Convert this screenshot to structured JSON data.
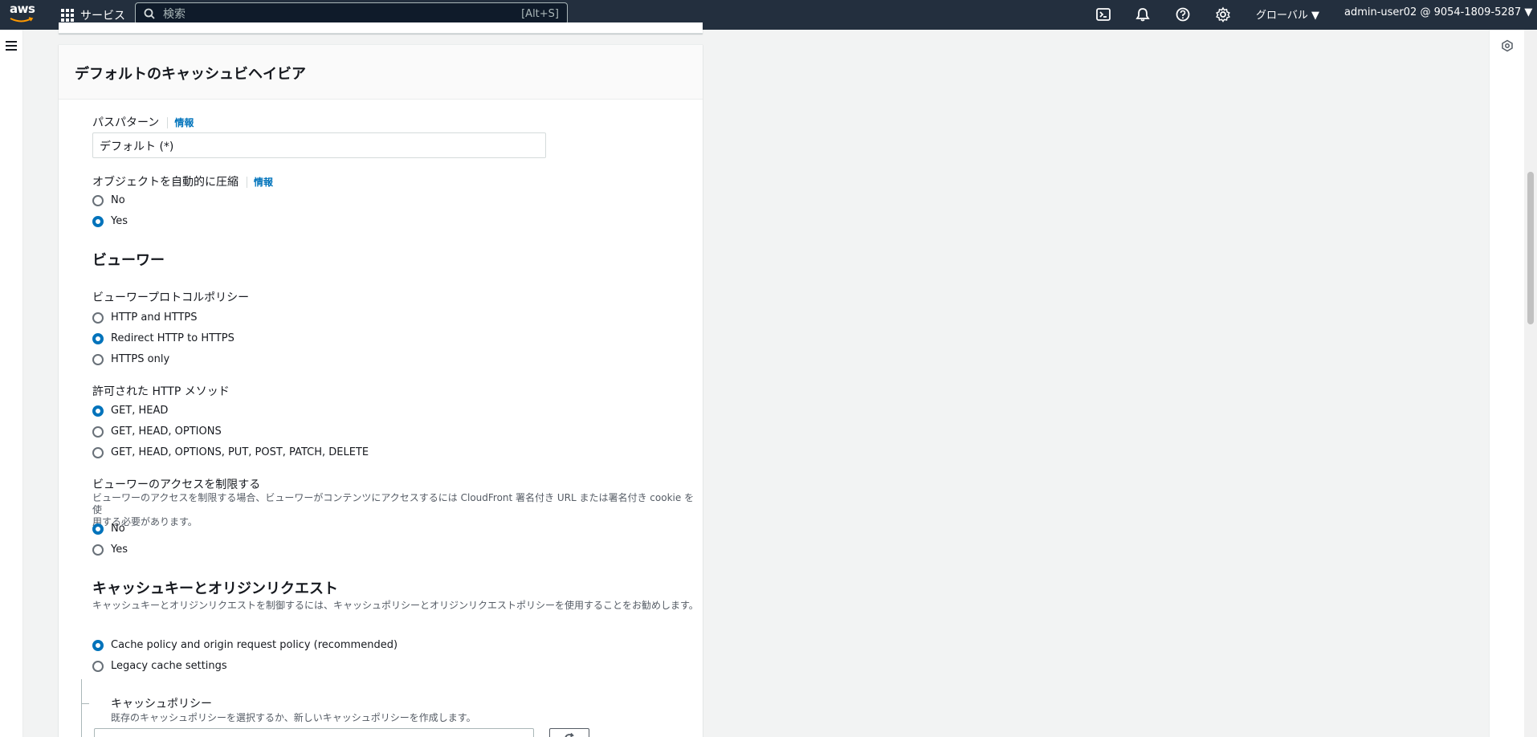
{
  "nav": {
    "logo_text": "aws",
    "services_label": "サービス",
    "search_placeholder": "検索",
    "search_shortcut": "[Alt+S]",
    "region": "グローバル ▼",
    "account": "admin-user02 @ 9054-1809-5287 ▼",
    "icons": [
      "cloudshell-icon",
      "bell-icon",
      "help-icon",
      "settings-icon"
    ]
  },
  "panel": {
    "title": "デフォルトのキャッシュビヘイビア",
    "path_pattern": {
      "label": "パスパターン",
      "info": "情報",
      "value": "デフォルト (*)"
    },
    "compress": {
      "label": "オブジェクトを自動的に圧縮",
      "info": "情報",
      "options": [
        {
          "label": "No",
          "checked": false
        },
        {
          "label": "Yes",
          "checked": true
        }
      ]
    },
    "viewer": {
      "title": "ビューワー",
      "protocol": {
        "label": "ビューワープロトコルポリシー",
        "options": [
          {
            "label": "HTTP and HTTPS",
            "checked": false
          },
          {
            "label": "Redirect HTTP to HTTPS",
            "checked": true
          },
          {
            "label": "HTTPS only",
            "checked": false
          }
        ]
      },
      "methods": {
        "label": "許可された HTTP メソッド",
        "options": [
          {
            "label": "GET, HEAD",
            "checked": true
          },
          {
            "label": "GET, HEAD, OPTIONS",
            "checked": false
          },
          {
            "label": "GET, HEAD, OPTIONS, PUT, POST, PATCH, DELETE",
            "checked": false
          }
        ]
      },
      "restrict": {
        "label": "ビューワーのアクセスを制限する",
        "desc_line1": "ビューワーのアクセスを制限する場合、ビューワーがコンテンツにアクセスするには CloudFront 署名付き URL または署名付き cookie を使",
        "desc_line2": "用する必要があります。",
        "options": [
          {
            "label": "No",
            "checked": true
          },
          {
            "label": "Yes",
            "checked": false
          }
        ]
      }
    },
    "cache_key": {
      "title": "キャッシュキーとオリジンリクエスト",
      "desc": "キャッシュキーとオリジンリクエストを制御するには、キャッシュポリシーとオリジンリクエストポリシーを使用することをお勧めします。",
      "options": [
        {
          "label": "Cache policy and origin request policy (recommended)",
          "checked": true
        },
        {
          "label": "Legacy cache settings",
          "checked": false
        }
      ],
      "cache_policy": {
        "label": "キャッシュポリシー",
        "desc": "既存のキャッシュポリシーを選択するか、新しいキャッシュポリシーを作成します。"
      }
    }
  }
}
